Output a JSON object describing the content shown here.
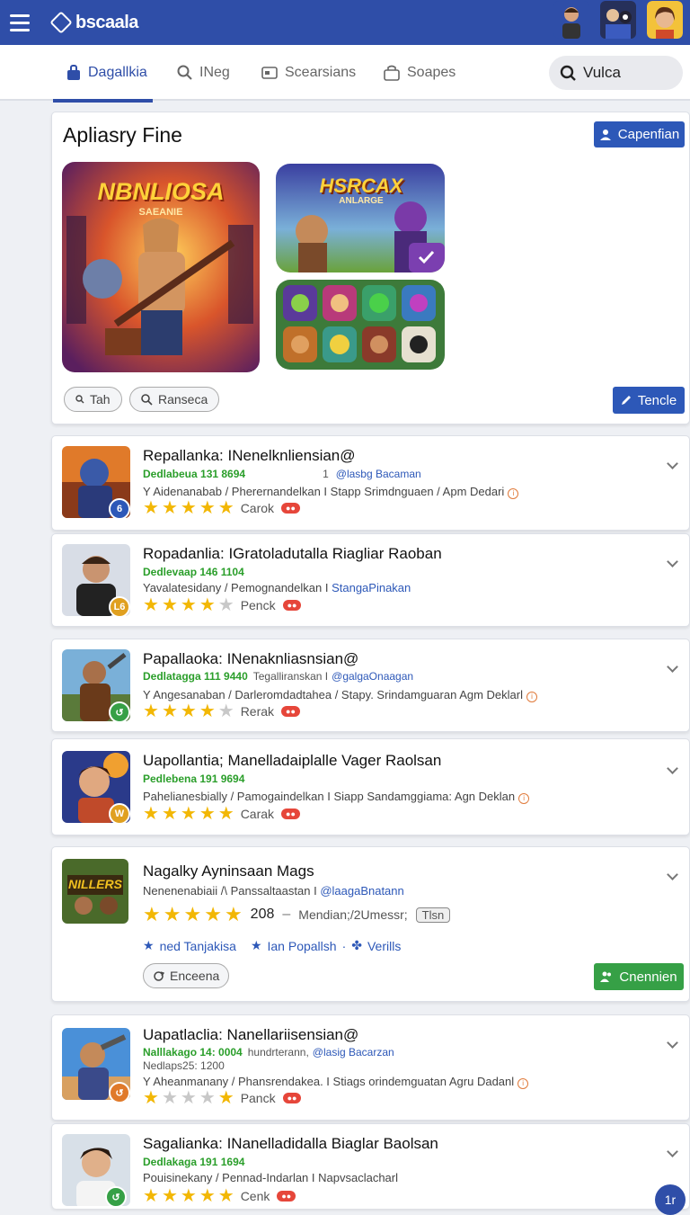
{
  "header": {
    "app_title": "bscaala",
    "icons": [
      "menu-icon",
      "logo-icon",
      "user-avatar-1",
      "user-avatar-2",
      "user-avatar-3"
    ]
  },
  "tabs": [
    {
      "label": "Dagallkia",
      "icon": "store-icon",
      "active": true
    },
    {
      "label": "INeg",
      "icon": "search-person-icon",
      "active": false
    },
    {
      "label": "Scearsians",
      "icon": "screen-icon",
      "active": false
    },
    {
      "label": "Soapes",
      "icon": "bag-icon",
      "active": false
    }
  ],
  "search": {
    "text": "Vulca"
  },
  "featured": {
    "title": "Apliasry Fine",
    "top_button": "Capenfian",
    "hero_art_title": "NBNLIOSA",
    "hero_art_subtitle": "SAEANIE",
    "second_art_title": "HSRCAX",
    "second_art_subtitle": "ANLARGE",
    "chips": [
      "Tah",
      "Ranseca"
    ],
    "action_button": "Tencle"
  },
  "items": [
    {
      "title": "Repallanka: INenelknliensian@",
      "sub_green": "Dedlabeua 131 8694",
      "sub_extra": "1",
      "sub_blue": "@lasbg Bacaman",
      "line": "Y Aidenanabab / Pherernandelkan I Stapp Srimdnguaen / Apm Dedari",
      "rating_label": "Carok",
      "stars": 5
    },
    {
      "title": "Ropadanlia: IGratoladutalla Riagliar Raoban",
      "sub_green": "Dedlevaap 146 1104",
      "line_gray": "Yavalatesidany / Pemognandelkan I ",
      "line_blue": "StangaPinakan",
      "rating_label": "Penck",
      "stars": 4
    },
    {
      "title": "Papallaoka: INenaknliasnsian@",
      "sub_green": "Dedlatagga 111 9440",
      "sub_gray": "Tegalliranskan I",
      "sub_blue": "@galgaOnaagan",
      "line": "Y Angesanaban / Darleromdadtahea / Stapy. Srindamguaran Agm Deklarl",
      "rating_label": "Rerak",
      "stars": 4
    },
    {
      "title": "Uapollantia; Manelladaiplalle Vager Raolsan",
      "sub_green": "Pedlebena 191 9694",
      "line": "Pahelianesbially / Pamogaindelkan I Siapp Sandamggiama: Agn Deklan",
      "rating_label": "Carak",
      "stars": 5
    },
    {
      "title": "Nagalky Ayninsaan Mags",
      "line_gray": "Nenenenabiaii /\\ Panssaltaastan I ",
      "line_blue": "@laagaBnatann",
      "rating_value": "208",
      "rating_meta": "Mendian;/2Umessr;",
      "rating_chip": "Tlsn",
      "meta_links": [
        "ned Tanjakisa",
        "Ian Popallsh",
        "Verills"
      ],
      "chip": "Enceena",
      "button": "Cnennien",
      "stars": 5
    },
    {
      "title": "Uapatlaclia: Nanellariisensian@",
      "sub_green": "Nalllakago 14: 0004",
      "sub_gray": "hundrterann,",
      "sub_blue": "@lasig Bacarzan",
      "sub2": "Nedlaps25: 1200",
      "line": "Y Aheanmanany / Phansrendakea. I Stiags orindemguatan Agru Dadanl",
      "rating_label": "Panck",
      "stars": 2
    },
    {
      "title": "Sagalianka: INanelladidalla Biaglar Baolsan",
      "sub_green": "Dedlakaga 191 1694",
      "line": "Pouisinekany / Pennad-Indarlan I Napvsaclacharl",
      "rating_label": "Cenk",
      "stars": 5
    }
  ],
  "fab_label": "1r",
  "colors": {
    "primary": "#2f4ea8",
    "accent_green": "#36a046",
    "star": "#f2b705",
    "tag": "#e6463a"
  }
}
